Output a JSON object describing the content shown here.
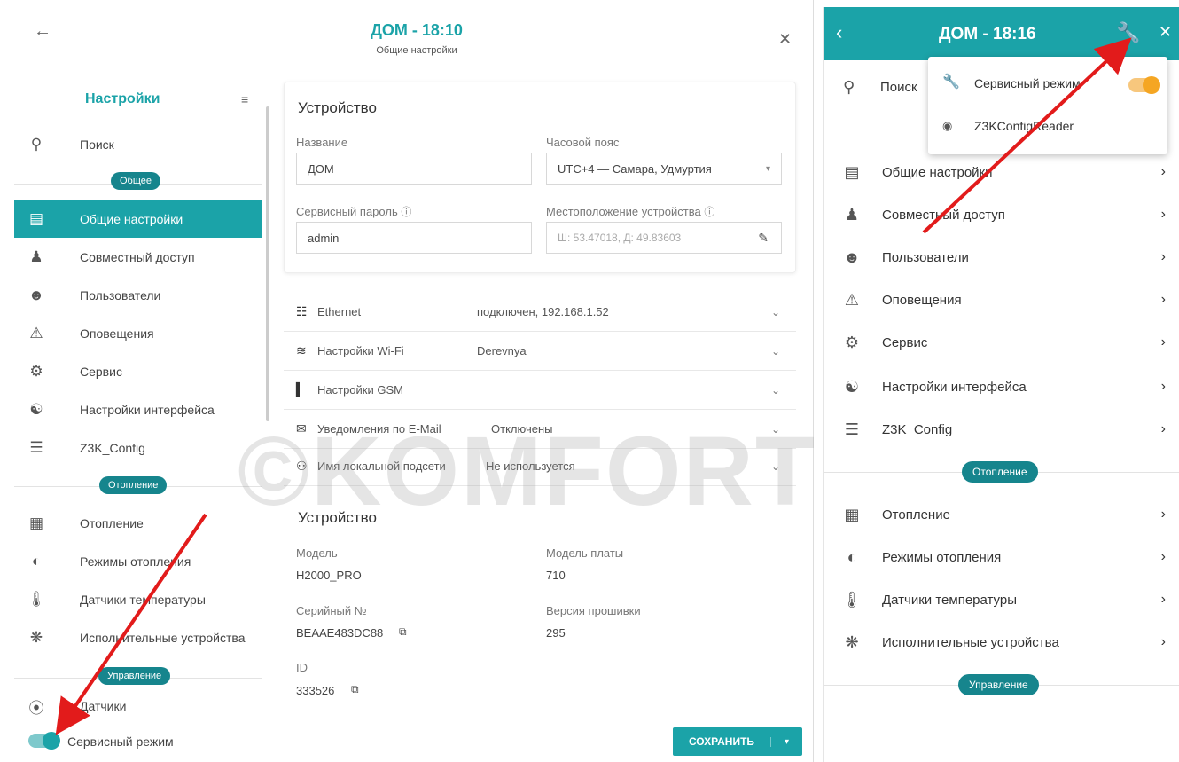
{
  "left": {
    "title": "ДОМ - 18:10",
    "subtitle": "Общие настройки",
    "sidebar_title": "Настройки",
    "search_label": "Поиск",
    "group_general": "Общее",
    "items_general": [
      {
        "label": "Общие настройки",
        "icon": "sliders-icon"
      },
      {
        "label": "Совместный доступ",
        "icon": "group-icon"
      },
      {
        "label": "Пользователи",
        "icon": "users-icon"
      },
      {
        "label": "Оповещения",
        "icon": "alert-icon"
      },
      {
        "label": "Сервис",
        "icon": "service-icon"
      },
      {
        "label": "Настройки интерфейса",
        "icon": "interface-icon"
      },
      {
        "label": "Z3K_Config",
        "icon": "config-icon"
      }
    ],
    "group_heating": "Отопление",
    "items_heating": [
      {
        "label": "Отопление",
        "icon": "radiator-icon"
      },
      {
        "label": "Режимы отопления",
        "icon": "modes-icon"
      },
      {
        "label": "Датчики температуры",
        "icon": "thermometer-icon"
      },
      {
        "label": "Исполнительные устройства",
        "icon": "actuator-icon"
      }
    ],
    "group_control": "Управление",
    "cut_item": "Датчики",
    "service_mode_label": "Сервисный режим",
    "device_section": {
      "title": "Устройство",
      "name_label": "Название",
      "name_value": "ДОМ",
      "tz_label": "Часовой пояс",
      "tz_value": "UTC+4 — Самара, Удмуртия",
      "pwd_label": "Сервисный пароль",
      "pwd_value": "admin",
      "loc_label": "Местоположение устройства",
      "loc_placeholder": "Ш: 53.47018, Д: 49.83603"
    },
    "accordions": [
      {
        "name": "Ethernet",
        "value": "подключен, 192.168.1.52",
        "icon": "ethernet-icon"
      },
      {
        "name": "Настройки Wi-Fi",
        "value": "Derevnya",
        "icon": "wifi-icon"
      },
      {
        "name": "Настройки GSM",
        "value": "",
        "icon": "signal-icon"
      },
      {
        "name": "Уведомления по E-Mail",
        "value": "Отключены",
        "icon": "mail-icon"
      },
      {
        "name": "Имя локальной подсети",
        "value": "Не используется",
        "icon": "subnet-icon"
      }
    ],
    "info_section": {
      "title": "Устройство",
      "model_label": "Модель",
      "model_value": "H2000_PRO",
      "board_label": "Модель платы",
      "board_value": "710",
      "serial_label": "Серийный №",
      "serial_value": "BEAAE483DC88",
      "fw_label": "Версия прошивки",
      "fw_value": "295",
      "id_label": "ID",
      "id_value": "333526"
    },
    "save_label": "СОХРАНИТЬ"
  },
  "right": {
    "title": "ДОМ - 18:16",
    "search_label": "Поиск",
    "popup": {
      "service_mode": "Сервисный режим",
      "config_reader": "Z3KConfigReader"
    },
    "items_general": [
      "Общие настройки",
      "Совместный доступ",
      "Пользователи",
      "Оповещения",
      "Сервис",
      "Настройки интерфейса",
      "Z3K_Config"
    ],
    "group_heating": "Отопление",
    "items_heating": [
      "Отопление",
      "Режимы отопления",
      "Датчики температуры",
      "Исполнительные устройства"
    ],
    "group_control": "Управление"
  },
  "watermark": "©KOMFORT",
  "colors": {
    "accent": "#1ba3a8",
    "dark_accent": "#16858d",
    "toggle": "#f5a623",
    "arrow": "#e21b1b"
  }
}
